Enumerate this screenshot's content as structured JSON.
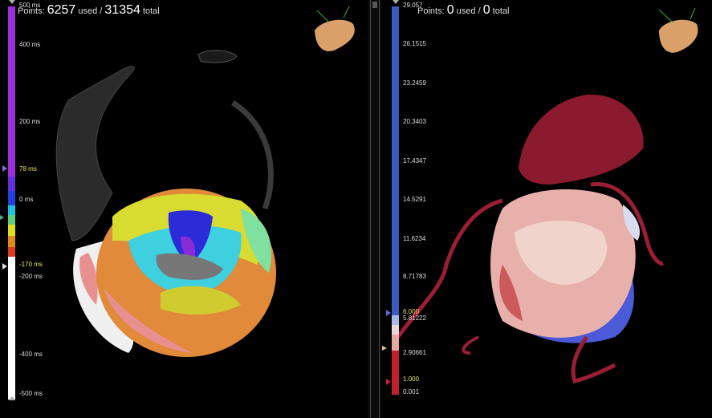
{
  "left_panel": {
    "points_label": "Points:",
    "points_used": "6257",
    "used_label": "used /",
    "points_total": "31354",
    "total_label": "total",
    "scale": {
      "top_label": "500 ms",
      "ticks": [
        "400 ms",
        "200 ms",
        "78 ms",
        "0 ms",
        "-170 ms",
        "-200 ms",
        "-400 ms",
        "-500 ms"
      ]
    }
  },
  "right_panel": {
    "points_label": "Points:",
    "points_used": "0",
    "used_label": "used /",
    "points_total": "0",
    "total_label": "total",
    "scale": {
      "top_label": "29.057",
      "ticks": [
        "26.1515",
        "23.2459",
        "20.3403",
        "17.4347",
        "14.5291",
        "11.6234",
        "8.71783",
        "6.000",
        "5.81222",
        "2.90661",
        "1.000",
        "0.001"
      ]
    }
  },
  "colors": {
    "activation_purple": "#9b30d8",
    "voltage_blue": "#3b5bbf",
    "anatomy_red": "#8b1a2e",
    "orientation_skin": "#d9a06a"
  },
  "icons": [
    "orientation-heart-icon",
    "marker-triangle-icon"
  ]
}
